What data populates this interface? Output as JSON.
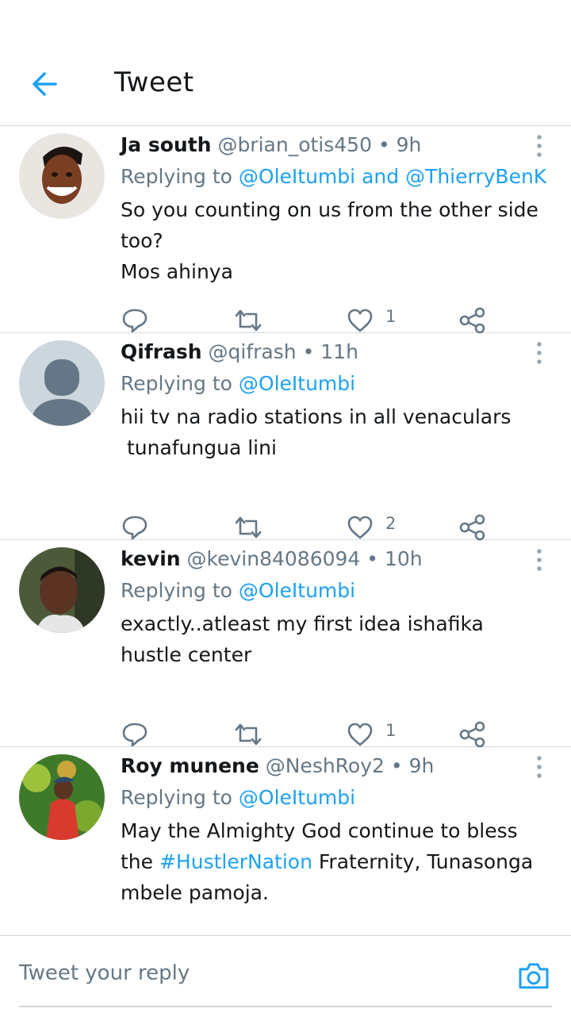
{
  "header": {
    "title": "Tweet",
    "back_icon": "arrow-left-icon"
  },
  "colors": {
    "accent": "#1da1f2",
    "secondary_text": "#657786"
  },
  "tweets": [
    {
      "name": "Ja south",
      "handle": "@brian_otis450",
      "dot": "•",
      "time": "9h",
      "reply_prefix": "Replying to",
      "mentions": [
        "@OleItumbi",
        "@ThierryBenK"
      ],
      "reply_joiner": "and",
      "lines": [
        "So you counting on us from the other side",
        "too?",
        "Mos ahinya"
      ],
      "likes": "1"
    },
    {
      "name": "Qifrash",
      "handle": "@qifrash",
      "dot": "•",
      "time": "11h",
      "reply_prefix": "Replying to",
      "mentions": [
        "@OleItumbi"
      ],
      "lines": [
        "hii tv na radio stations in all venaculars",
        " tunafungua lini"
      ],
      "likes": "2"
    },
    {
      "name": "kevin",
      "handle": "@kevin84086094",
      "dot": "•",
      "time": "10h",
      "reply_prefix": "Replying to",
      "mentions": [
        "@OleItumbi"
      ],
      "lines": [
        "exactly..atleast my first idea ishafika",
        "hustle center"
      ],
      "likes": "1"
    },
    {
      "name": "Roy munene",
      "handle": "@NeshRoy2",
      "dot": "•",
      "time": "9h",
      "reply_prefix": "Replying to",
      "mentions": [
        "@OleItumbi"
      ],
      "line1_prefix": "May the Almighty God continue to bless",
      "line2_start": "the",
      "hashtag": "#HustlerNation",
      "line2_end": "Fraternity, Tunasonga",
      "line3": "mbele pamoja."
    }
  ],
  "reply_bar": {
    "placeholder": "Tweet your reply",
    "camera_icon": "camera-icon"
  }
}
